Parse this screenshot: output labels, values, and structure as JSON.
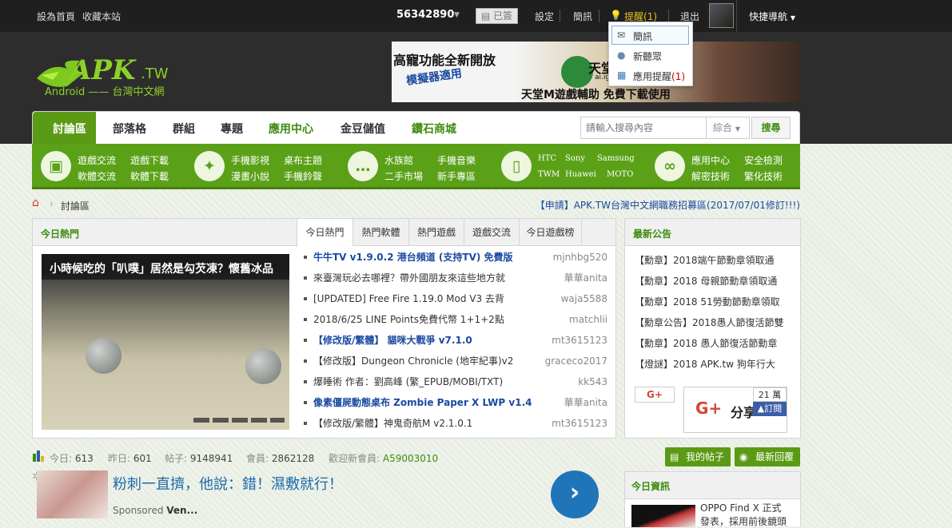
{
  "topbar": {
    "set_home": "設為首頁",
    "bookmark": "收藏本站",
    "user_id": "56342890",
    "signed": "已簽",
    "settings": "設定",
    "messages": "簡訊",
    "reminders_label": "提醒",
    "reminders_count": "(1)",
    "logout": "退出",
    "quick_nav": "快捷導航"
  },
  "dropdown": {
    "messages": "簡訊",
    "new_listeners": "新聽眾",
    "app_reminder_label": "應用提醒",
    "app_reminder_count": "(1)"
  },
  "logo": {
    "main": "APK",
    "suffix": ".TW",
    "sub": "Android —— 台灣中文網"
  },
  "banner": {
    "line1": "高寵功能全新開放",
    "line2": "模擬器適用",
    "brand": "天堂",
    "brand_sub": "ai.ig",
    "tagline": "天堂M遊戲輔助 免費下載使用"
  },
  "nav": {
    "items": [
      "討論區",
      "部落格",
      "群組",
      "專題",
      "應用中心",
      "金豆儲值",
      "鑽石商城"
    ],
    "search_placeholder": "請輸入搜尋內容",
    "search_scope": "綜合",
    "search_button": "搜尋"
  },
  "catbar": {
    "groups": [
      {
        "icon": "android-icon",
        "links": [
          "遊戲交流",
          "遊戲下載",
          "軟體交流",
          "軟體下載"
        ]
      },
      {
        "icon": "wand-icon",
        "links": [
          "手機影視",
          "桌布主題",
          "漫畫小說",
          "手機鈴聲"
        ]
      },
      {
        "icon": "chat-icon",
        "links": [
          "水族館",
          "手機音樂",
          "二手市場",
          "新手專區"
        ]
      },
      {
        "icon": "phone-icon",
        "links": [
          "HTC",
          "Sony",
          "Samsung",
          "TWM",
          "Huawei",
          "MOTO"
        ]
      },
      {
        "icon": "link-icon",
        "links": [
          "應用中心",
          "安全檢測",
          "解密技術",
          "繁化技術"
        ]
      }
    ]
  },
  "breadcrumb": {
    "current": "討論區",
    "announcement": "【申請】APK.TW台灣中文網職務招募區(2017/07/01修訂!!!)"
  },
  "hot": {
    "title": "今日熱門",
    "slide_caption": "小時候吃的「叭噗」居然是勾芡凍？懷舊冰品",
    "tabs": [
      "今日熱門",
      "熱門軟體",
      "熱門遊戲",
      "遊戲交流",
      "今日遊戲榜"
    ],
    "posts": [
      {
        "title": "牛牛TV v1.9.0.2 港台頻道 (支持TV) 免費版",
        "author": "mjnhbg520",
        "highlight": true
      },
      {
        "title": "來臺灣玩必去哪裡？帶外國朋友來這些地方就",
        "author": "華華anita",
        "highlight": false
      },
      {
        "title": "[UPDATED] Free Fire 1.19.0 Mod V3 去背",
        "author": "waja5588",
        "highlight": false
      },
      {
        "title": "2018/6/25 LINE Points免費代幣 1+1+2點",
        "author": "matchlii",
        "highlight": false
      },
      {
        "title": "【修改版/繁體】 貓咪大戰爭 v7.1.0",
        "author": "mt3615123",
        "highlight": true
      },
      {
        "title": "【修改版】Dungeon Chronicle (地牢紀事)v2",
        "author": "graceco2017",
        "highlight": false
      },
      {
        "title": "爆睡術 作者：劉高峰 (繁_EPUB/MOBI/TXT)",
        "author": "kk543",
        "highlight": false
      },
      {
        "title": "像素僵屍動態桌布 Zombie Paper X LWP v1.4",
        "author": "華華anita",
        "highlight": true
      },
      {
        "title": "【修改版/繁體】神鬼奇航M v2.1.0.1",
        "author": "mt3615123",
        "highlight": false
      }
    ]
  },
  "notices": {
    "title": "最新公告",
    "items": [
      "【勳章】2018端午節勳章領取通",
      "【勳章】2018 母親節勳章領取通",
      "【勳章】2018 51勞動節勳章領取",
      "【勳章公告】2018愚人節復活節雙",
      "【勳章】2018 愚人節復活節勳章",
      "【燈謎】2018 APK.tw 狗年行大"
    ],
    "gplus_small": "G+",
    "gplus_big": "G+",
    "share": "分享",
    "share_count": "21 萬",
    "share_sub": "訂閱"
  },
  "stats": {
    "today_label": "今日:",
    "today": "613",
    "yesterday_label": "昨日:",
    "yesterday": "601",
    "posts_label": "帖子:",
    "posts": "9148941",
    "members_label": "會員:",
    "members": "2862128",
    "welcome_label": "歡迎新會員:",
    "new_member": "A59003010",
    "my_posts": "我的帖子",
    "latest_replies": "最新回覆"
  },
  "ad": {
    "headline": "粉刺一直擠，他說：錯！濕敷就行！",
    "sponsor_prefix": "Sponsored ",
    "sponsor": "Ven..."
  },
  "daily": {
    "title": "今日資訊",
    "text1": "OPPO Find X 正式",
    "text2": "發表，採用前後鏡頭"
  },
  "colors": {
    "brand_green": "#5a9a14",
    "link_blue": "#2a5ea6",
    "topbar": "#1f1f1f",
    "accent_red": "#c00000"
  }
}
